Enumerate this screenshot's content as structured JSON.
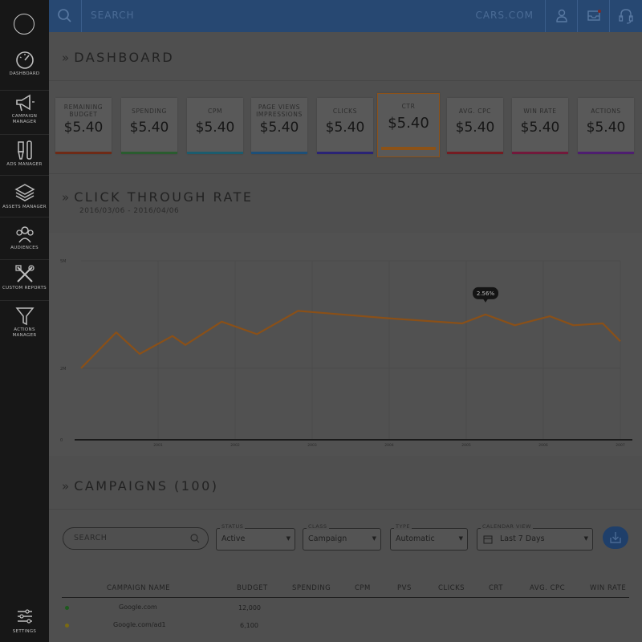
{
  "app": {
    "search_placeholder": "SEARCH",
    "brand": "CARS.COM"
  },
  "sidebar": {
    "items": [
      {
        "label": "DASHBOARD",
        "icon": "speedometer-icon"
      },
      {
        "label": "CAMPAIGN\nMANAGER",
        "icon": "megaphone-icon"
      },
      {
        "label": "ADS MANAGER",
        "icon": "brush-icon"
      },
      {
        "label": "ASSETS MANAGER",
        "icon": "layers-icon"
      },
      {
        "label": "AUDIENCES",
        "icon": "people-icon"
      },
      {
        "label": "CUSTOM REPORTS",
        "icon": "tools-icon"
      },
      {
        "label": "ACTIONS\nMANAGER",
        "icon": "funnel-icon"
      }
    ],
    "settings_label": "SETTINGS"
  },
  "dashboard": {
    "title": "DASHBOARD",
    "cards": [
      {
        "label": "REMAINING BUDGET",
        "value": "$5.40",
        "color": "#6e2a16"
      },
      {
        "label": "SPENDING",
        "value": "$5.40",
        "color": "#2a5c2f"
      },
      {
        "label": "CPM",
        "value": "$5.40",
        "color": "#1c5c6e"
      },
      {
        "label": "PAGE VIEWS IMPRESSIONS",
        "value": "$5.40",
        "color": "#1d4f78"
      },
      {
        "label": "CLICKS",
        "value": "$5.40",
        "color": "#2a2375"
      },
      {
        "label": "CTR",
        "value": "$5.40",
        "color": "#8c5217"
      },
      {
        "label": "AVG. CPC",
        "value": "$5.40",
        "color": "#741c22"
      },
      {
        "label": "WIN RATE",
        "value": "$5.40",
        "color": "#72193b"
      },
      {
        "label": "ACTIONS",
        "value": "$5.40",
        "color": "#4e1e70"
      }
    ]
  },
  "ctr_section": {
    "title": "CLICK THROUGH RATE",
    "date_range": "2016/03/06 - 2016/04/06",
    "tooltip": "2.56%"
  },
  "chart_data": {
    "type": "line",
    "y_tick_labels": [
      "5M",
      "2M",
      "0"
    ],
    "x_tick_labels": [
      "2001",
      "2002",
      "2003",
      "2004",
      "2005",
      "2006",
      "2007"
    ],
    "ylim": [
      0,
      5
    ],
    "points": [
      [
        0.0,
        2.0
      ],
      [
        0.3,
        3.0
      ],
      [
        0.5,
        2.4
      ],
      [
        0.78,
        2.9
      ],
      [
        0.89,
        2.65
      ],
      [
        1.2,
        3.3
      ],
      [
        1.5,
        2.95
      ],
      [
        1.85,
        3.6
      ],
      [
        2.6,
        3.4
      ],
      [
        3.25,
        3.25
      ],
      [
        3.45,
        3.5
      ],
      [
        3.7,
        3.2
      ],
      [
        4.0,
        3.45
      ],
      [
        4.2,
        3.2
      ],
      [
        4.45,
        3.25
      ],
      [
        4.6,
        2.75
      ]
    ],
    "line_color": "#8a5018"
  },
  "campaigns": {
    "title": "CAMPAIGNS (100)",
    "search_placeholder": "SEARCH",
    "filters": [
      {
        "label": "STATUS",
        "value": "Active"
      },
      {
        "label": "CLASS",
        "value": "Campaign"
      },
      {
        "label": "TYPE",
        "value": "Automatic"
      },
      {
        "label": "CALENDAR VIEW",
        "value": "Last 7 Days"
      }
    ],
    "columns": [
      "CAMPAIGN NAME",
      "BUDGET",
      "SPENDING",
      "CPM",
      "PVS",
      "CLICKS",
      "CRT",
      "AVG. CPC",
      "WIN RATE"
    ],
    "rows": [
      {
        "name": "Google.com",
        "budget": "12,000",
        "dot": "#1e5a1e"
      },
      {
        "name": "Google.com/ad1",
        "budget": "6,100",
        "dot": "#7a6a12"
      }
    ]
  }
}
